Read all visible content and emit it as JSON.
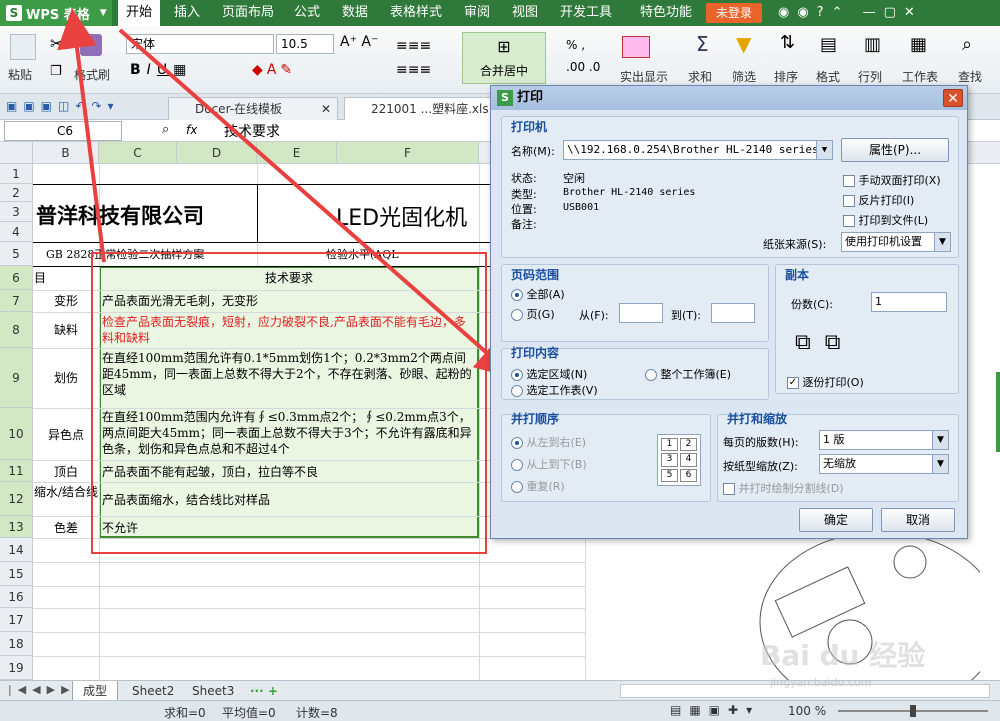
{
  "app": {
    "title": "WPS 表格",
    "login": "未登录"
  },
  "menu": [
    "开始",
    "插入",
    "页面布局",
    "公式",
    "数据",
    "表格样式",
    "审阅",
    "视图",
    "开发工具",
    "特色功能"
  ],
  "ribbon": {
    "paste": "粘贴",
    "format_painter": "格式刷",
    "font": "宋体",
    "size": "10.5",
    "merge": "合并居中",
    "show": "实出显示",
    "sum": "求和",
    "filter": "筛选",
    "sort": "排序",
    "format": "格式",
    "rowcol": "行列",
    "sheet": "工作表",
    "find": "查找"
  },
  "tabs": [
    {
      "label": "Docer-在线模板"
    },
    {
      "label": "221001 ...塑料座.xls"
    }
  ],
  "formula": {
    "cellref": "C6",
    "fx": "fx",
    "value": "技术要求"
  },
  "columns": [
    "B",
    "C",
    "D",
    "E",
    "F",
    "G"
  ],
  "rows": [
    "1",
    "2",
    "3",
    "4",
    "5",
    "6",
    "7",
    "8",
    "9",
    "10",
    "11",
    "12",
    "13",
    "14",
    "15",
    "16",
    "17",
    "18",
    "19"
  ],
  "sheet": {
    "company": "普洋科技有限公司",
    "product": "LED光固化机",
    "r5a": "GB 2828正常检验二次抽样方案",
    "r5b": "检验水平(AQL",
    "r6b": "目",
    "header": "技术要求",
    "items": [
      {
        "name": "变形",
        "req": "产品表面光滑无毛刺，无变形",
        "red": false
      },
      {
        "name": "缺料",
        "req": "检查产品表面无裂痕，短射，应力破裂不良,产品表面不能有毛边，多料和缺料",
        "red": true
      },
      {
        "name": "划伤",
        "req": "在直经100mm范围允许有0.1*5mm划伤1个；0.2*3mm2个两点间距45mm，同一表面上总数不得大于2个，不存在剥落、砂眼、起粉的区域",
        "red": false
      },
      {
        "name": "异色点",
        "req": "在直经100mm范围内允许有∮≤0.3mm点2个；∮≤0.2mm点3个，两点间距大45mm；同一表面上总数不得大于3个；不允许有露底和异色条，划伤和异色点总和不超过4个",
        "red": false
      },
      {
        "name": "顶白",
        "req": "产品表面不能有起皱，顶白，拉白等不良",
        "red": false
      },
      {
        "name": "缩水/结合线",
        "req": "产品表面缩水，结合线比对样品",
        "red": false
      },
      {
        "name": "色差",
        "req": "不允许",
        "red": false
      }
    ]
  },
  "sheet_tabs": [
    "成型",
    "Sheet2",
    "Sheet3"
  ],
  "status": {
    "sum": "求和=0",
    "avg": "平均值=0",
    "count": "计数=8",
    "zoom": "100 %"
  },
  "dialog": {
    "title": "打印",
    "printer_group": "打印机",
    "name_label": "名称(M):",
    "printer": "\\\\192.168.0.254\\Brother HL-2140 series",
    "props": "属性(P)...",
    "status_label": "状态:",
    "status": "空闲",
    "type_label": "类型:",
    "type": "Brother HL-2140 series",
    "where_label": "位置:",
    "where": "USB001",
    "comment_label": "备注:",
    "duplex": "手动双面打印(X)",
    "reverse": "反片打印(I)",
    "tofile": "打印到文件(L)",
    "source_label": "纸张来源(S):",
    "source": "使用打印机设置",
    "range_group": "页码范围",
    "all": "全部(A)",
    "pages": "页(G)",
    "from": "从(F):",
    "to": "到(T):",
    "copies_group": "副本",
    "copies_label": "份数(C):",
    "copies": "1",
    "collate": "逐份打印(O)",
    "content_group": "打印内容",
    "selection": "选定区域(N)",
    "workbook": "整个工作簿(E)",
    "sheets": "选定工作表(V)",
    "order_group": "并打顺序",
    "ltr": "从左到右(E)",
    "ttb": "从上到下(B)",
    "repeat": "重复(R)",
    "scale_group": "并打和缩放",
    "per_page_label": "每页的版数(H):",
    "per_page": "1 版",
    "scale_label": "按纸型缩放(Z):",
    "scale": "无缩放",
    "divider": "并打时绘制分割线(D)",
    "ok": "确定",
    "cancel": "取消",
    "grid": [
      "1",
      "2",
      "3",
      "4",
      "5",
      "6"
    ]
  },
  "watermark": "Bai du 经验",
  "watermark2": "jingyan.baidu.com"
}
